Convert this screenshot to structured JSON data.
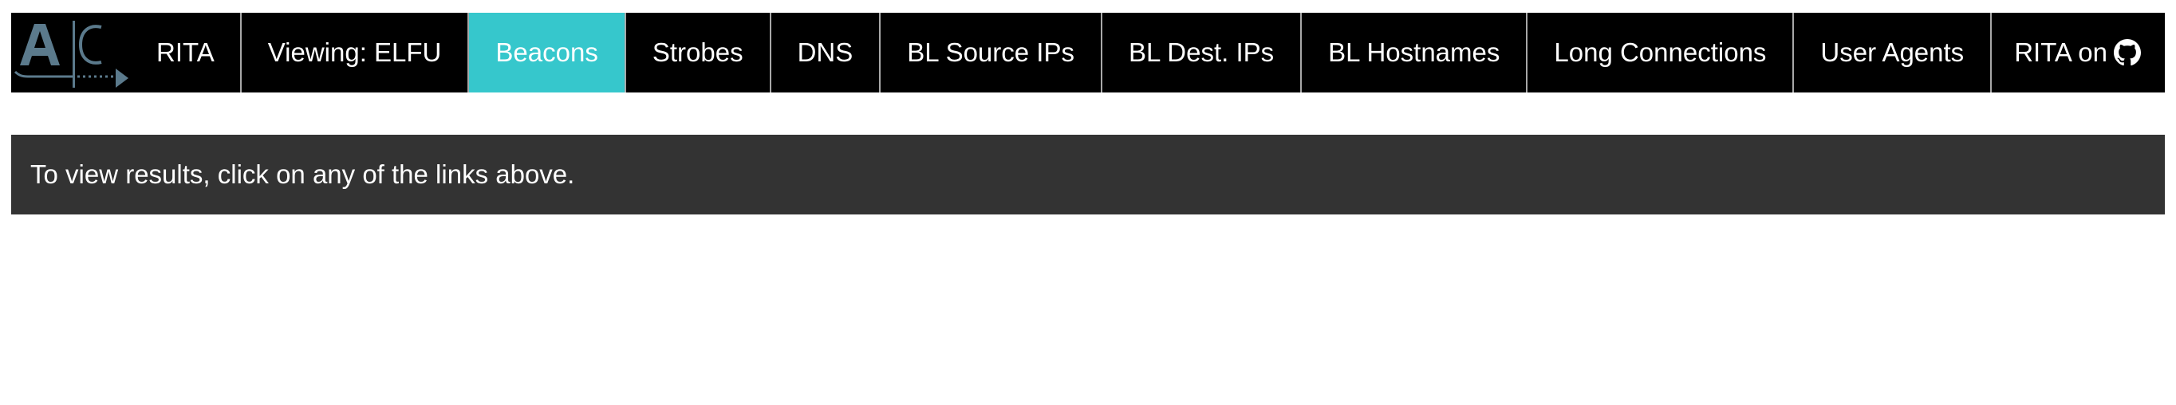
{
  "logo": {
    "icon": "ac-logo-icon",
    "color": "#5b7a8c"
  },
  "nav": {
    "items": [
      {
        "label": "RITA",
        "active": false
      },
      {
        "label": "Viewing: ELFU",
        "active": false
      },
      {
        "label": "Beacons",
        "active": true
      },
      {
        "label": "Strobes",
        "active": false
      },
      {
        "label": "DNS",
        "active": false
      },
      {
        "label": "BL Source IPs",
        "active": false
      },
      {
        "label": "BL Dest. IPs",
        "active": false
      },
      {
        "label": "BL Hostnames",
        "active": false
      },
      {
        "label": "Long Connections",
        "active": false
      },
      {
        "label": "User Agents",
        "active": false
      }
    ],
    "right_label": "RITA on",
    "right_icon": "github-icon"
  },
  "message": {
    "text": "To view results, click on any of the links above."
  },
  "colors": {
    "navbar_bg": "#000000",
    "active_bg": "#36c7cc",
    "message_bg": "#333333",
    "divider": "#a8a8a8"
  }
}
